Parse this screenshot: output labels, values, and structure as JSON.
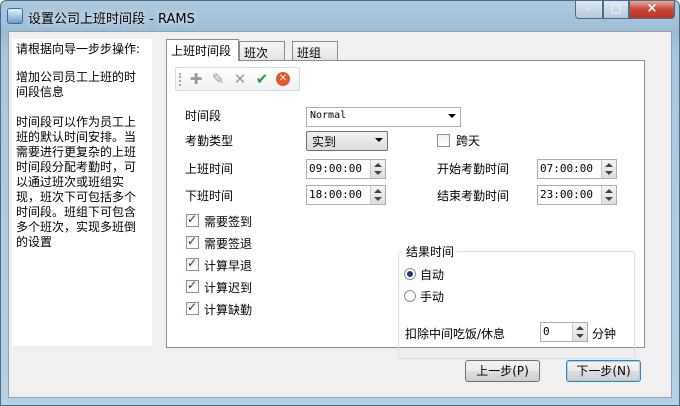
{
  "window": {
    "title": "设置公司上班时间段 - RAMS",
    "minimize_label": "-",
    "maximize_label": "□",
    "close_label": "×"
  },
  "guide": {
    "heading": "请根据向导一步步操作:",
    "step_title": "增加公司员工上班的时间段信息",
    "description": "时间段可以作为员工上班的默认时间安排。当需要进行更复杂的上班时间段分配考勤时，可以通过班次或班组实现，班次下可包括多个时间段。班组下可包含多个班次，实现多班倒的设置"
  },
  "tabs": [
    {
      "label": "上班时间段",
      "active": true
    },
    {
      "label": "班次",
      "active": false
    },
    {
      "label": "班组",
      "active": false
    }
  ],
  "toolbar": {
    "icons": [
      "add-icon",
      "edit-icon",
      "delete-icon",
      "confirm-icon",
      "cancel-icon"
    ]
  },
  "form": {
    "period": {
      "label": "时间段",
      "value": "Normal"
    },
    "attendance_type": {
      "label": "考勤类型",
      "value": "实到"
    },
    "cross_day": {
      "label": "跨天",
      "checked": false
    },
    "start_work": {
      "label": "上班时间",
      "value": "09:00:00"
    },
    "end_work": {
      "label": "下班时间",
      "value": "18:00:00"
    },
    "start_attendance": {
      "label": "开始考勤时间",
      "value": "07:00:00"
    },
    "end_attendance": {
      "label": "结束考勤时间",
      "value": "23:00:00"
    },
    "checkboxes": [
      {
        "label": "需要签到",
        "checked": true
      },
      {
        "label": "需要签退",
        "checked": true
      },
      {
        "label": "计算早退",
        "checked": true
      },
      {
        "label": "计算迟到",
        "checked": true
      },
      {
        "label": "计算缺勤",
        "checked": true
      }
    ],
    "result_group": {
      "title": "结果时间",
      "options": [
        {
          "label": "自动",
          "selected": true
        },
        {
          "label": "手动",
          "selected": false
        }
      ],
      "deduct_label": "扣除中间吃饭/休息",
      "deduct_value": "0",
      "deduct_unit": "分钟"
    }
  },
  "buttons": {
    "prev": "上一步(P)",
    "next": "下一步(N)"
  },
  "colors": {
    "titlebar": "#9dbdd6",
    "close_button": "#c8473a",
    "add_icon": "#a0a0a0",
    "confirm_icon": "#2e9b2e",
    "cancel_icon": "#e2572b"
  }
}
